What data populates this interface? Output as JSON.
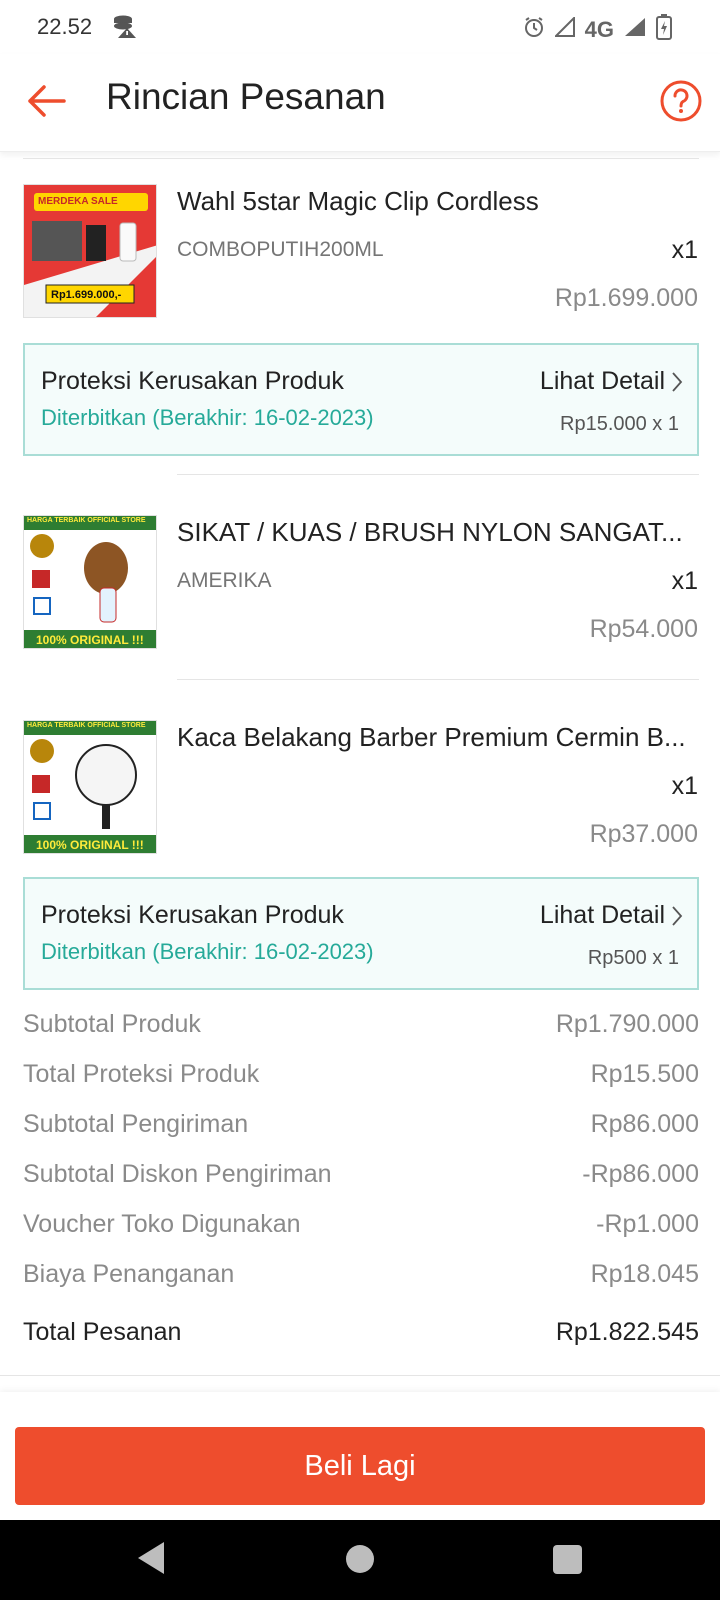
{
  "status_bar": {
    "time": "22.52",
    "network": "4G"
  },
  "header": {
    "title": "Rincian Pesanan"
  },
  "items": [
    {
      "name": "Wahl 5star Magic Clip Cordless",
      "variant": "COMBOPUTIH200ML",
      "qty": "x1",
      "price": "Rp1.699.000",
      "thumb_banner": "MERDEKA SALE",
      "thumb_price": "Rp1.699.000,-",
      "protection": {
        "title": "Proteksi Kerusakan Produk",
        "status": "Diterbitkan (Berakhir: 16-02-2023)",
        "link": "Lihat Detail",
        "price": "Rp15.000 x 1"
      }
    },
    {
      "name": "SIKAT / KUAS / BRUSH NYLON SANGAT...",
      "variant": "AMERIKA",
      "qty": "x1",
      "price": "Rp54.000",
      "thumb_top": "HARGA TERBAIK OFFICIAL STORE",
      "thumb_bottom": "100% ORIGINAL !!!"
    },
    {
      "name": "Kaca Belakang Barber Premium Cermin B...",
      "variant": "",
      "qty": "x1",
      "price": "Rp37.000",
      "thumb_top": "HARGA TERBAIK OFFICIAL STORE",
      "thumb_bottom": "100% ORIGINAL !!!",
      "protection": {
        "title": "Proteksi Kerusakan Produk",
        "status": "Diterbitkan (Berakhir: 16-02-2023)",
        "link": "Lihat Detail",
        "price": "Rp500 x 1"
      }
    }
  ],
  "summary": [
    {
      "label": "Subtotal Produk",
      "value": "Rp1.790.000"
    },
    {
      "label": "Total Proteksi Produk",
      "value": "Rp15.500"
    },
    {
      "label": "Subtotal Pengiriman",
      "value": "Rp86.000"
    },
    {
      "label": "Subtotal Diskon Pengiriman",
      "value": "-Rp86.000"
    },
    {
      "label": "Voucher Toko Digunakan",
      "value": "-Rp1.000"
    },
    {
      "label": "Biaya Penanganan",
      "value": "Rp18.045"
    }
  ],
  "total": {
    "label": "Total Pesanan",
    "value": "Rp1.822.545"
  },
  "action": {
    "buy_again_label": "Beli Lagi"
  },
  "colors": {
    "accent": "#ee4d2d",
    "teal": "#26aa99",
    "protect_border": "#a9ddd6",
    "protect_bg": "#f4fcfb"
  }
}
